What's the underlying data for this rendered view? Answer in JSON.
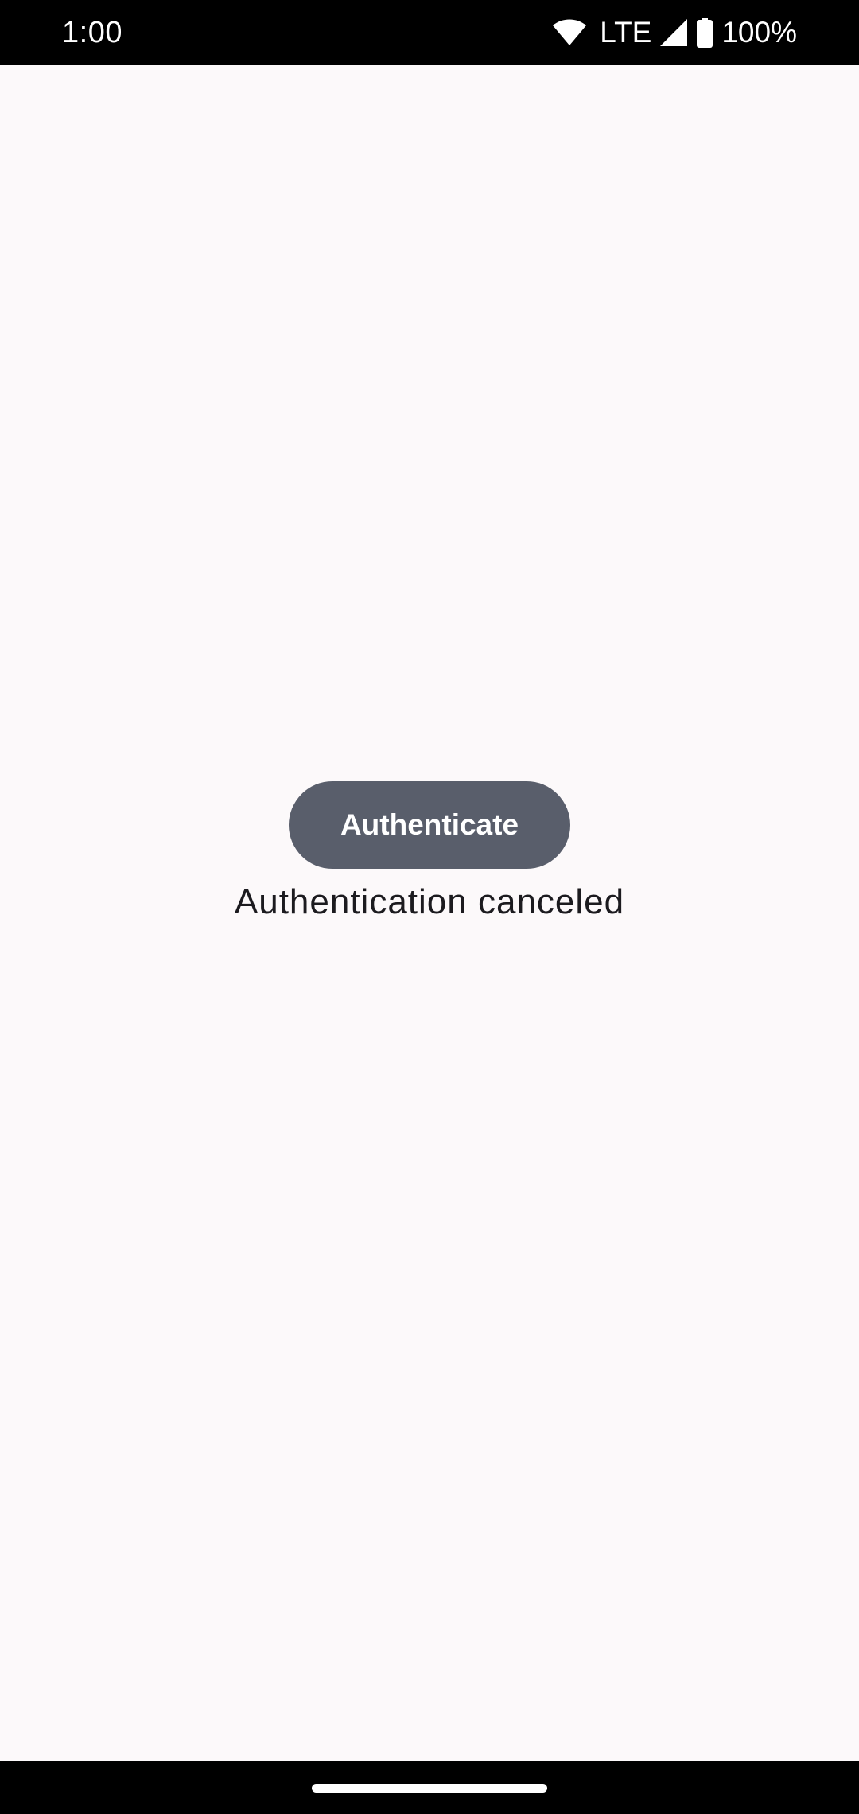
{
  "status_bar": {
    "time": "1:00",
    "network": "LTE",
    "battery": "100%",
    "icons": [
      "wifi-icon",
      "cell-signal-icon",
      "battery-icon"
    ]
  },
  "main": {
    "authenticate_button_label": "Authenticate",
    "status_message": "Authentication canceled"
  },
  "colors": {
    "background": "#fcf9fa",
    "button": "#595e6b",
    "text": "#1c1b1f",
    "system_bars": "#000000"
  }
}
